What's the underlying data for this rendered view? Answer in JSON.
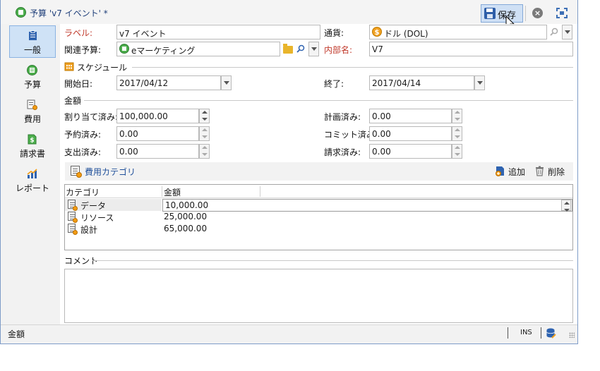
{
  "window": {
    "title": "予算 'v7 イベント' *",
    "save_label": "保存"
  },
  "sidebar": {
    "items": [
      {
        "label": "一般",
        "icon": "clipboard-icon",
        "active": true
      },
      {
        "label": "予算",
        "icon": "budget-icon",
        "active": false
      },
      {
        "label": "費用",
        "icon": "expense-icon",
        "active": false
      },
      {
        "label": "請求書",
        "icon": "invoice-icon",
        "active": false
      },
      {
        "label": "レポート",
        "icon": "report-chart-icon",
        "active": false
      }
    ]
  },
  "form": {
    "label_caption": "ラベル:",
    "label_value": "v7 イベント",
    "currency_caption": "通貨:",
    "currency_value": "ドル (DOL)",
    "related_budget_caption": "関連予算:",
    "related_budget_value": "eマーケティング",
    "internal_name_caption": "内部名:",
    "internal_name_value": "V7"
  },
  "schedule": {
    "section_title": "スケジュール",
    "start_caption": "開始日:",
    "start_value": "2017/04/12",
    "end_caption": "終了:",
    "end_value": "2017/04/14"
  },
  "amount": {
    "section_title": "金額",
    "allocated_caption": "割り当て済み:",
    "allocated_value": "100,000.00",
    "reserved_caption": "予約済み:",
    "reserved_value": "0.00",
    "spent_caption": "支出済み:",
    "spent_value": "0.00",
    "planned_caption": "計画済み:",
    "planned_value": "0.00",
    "committed_caption": "コミット済み:",
    "committed_value": "0.00",
    "invoiced_caption": "請求済み:",
    "invoiced_value": "0.00"
  },
  "categories": {
    "toolbar_label": "費用カテゴリ",
    "add_label": "追加",
    "delete_label": "削除",
    "columns": [
      "カテゴリ",
      "金額"
    ],
    "rows": [
      {
        "category": "データ",
        "amount": "10,000.00"
      },
      {
        "category": "リソース",
        "amount": "25,000.00"
      },
      {
        "category": "設計",
        "amount": "65,000.00"
      }
    ]
  },
  "comment": {
    "section_title": "コメント",
    "value": ""
  },
  "status": {
    "text": "金額",
    "mode": "INS"
  },
  "colors": {
    "accent": "#1f4f9a",
    "required": "#c0392b",
    "active_tab": "#cfe2f6"
  }
}
